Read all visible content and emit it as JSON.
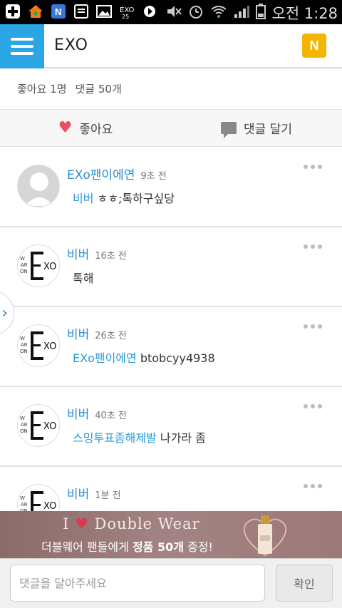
{
  "status_bar": {
    "time": "오전 1:28"
  },
  "header": {
    "title": "EXO",
    "badge": "N"
  },
  "stats": {
    "likes": "좋아요 1명",
    "comments": "댓글 50개"
  },
  "actions": {
    "like_label": "좋아요",
    "comment_label": "댓글 달기"
  },
  "comments": [
    {
      "author": "EXo팬이에연",
      "time": "9초 전",
      "mention": "비버",
      "text": " ㅎㅎ;톡하구싶당",
      "avatar": "default"
    },
    {
      "author": "비버",
      "time": "16초 전",
      "mention": "",
      "text": "톡해",
      "avatar": "exo"
    },
    {
      "author": "비버",
      "time": "26초 전",
      "mention": "EXo팬이에연",
      "text": " btobcyy4938",
      "avatar": "exo"
    },
    {
      "author": "비버",
      "time": "40초 전",
      "mention": "스밍투표좀해제발",
      "text": " 나가라 좀",
      "avatar": "exo"
    },
    {
      "author": "비버",
      "time": "1분 전",
      "mention": "",
      "text": "",
      "avatar": "exo"
    }
  ],
  "ad": {
    "line1_pre": "I",
    "line1_post": "Double Wear",
    "line2_pre": "더블웨어 팬들에게 ",
    "line2_strong": "정품 50개",
    "line2_post": " 증정!"
  },
  "input": {
    "placeholder": "댓글을 달아주세요",
    "value": ""
  },
  "confirm_label": "확인",
  "colors": {
    "accent": "#29a6e3",
    "badge": "#f5b400",
    "link": "#2b8ed0",
    "heart": "#e8505f"
  }
}
